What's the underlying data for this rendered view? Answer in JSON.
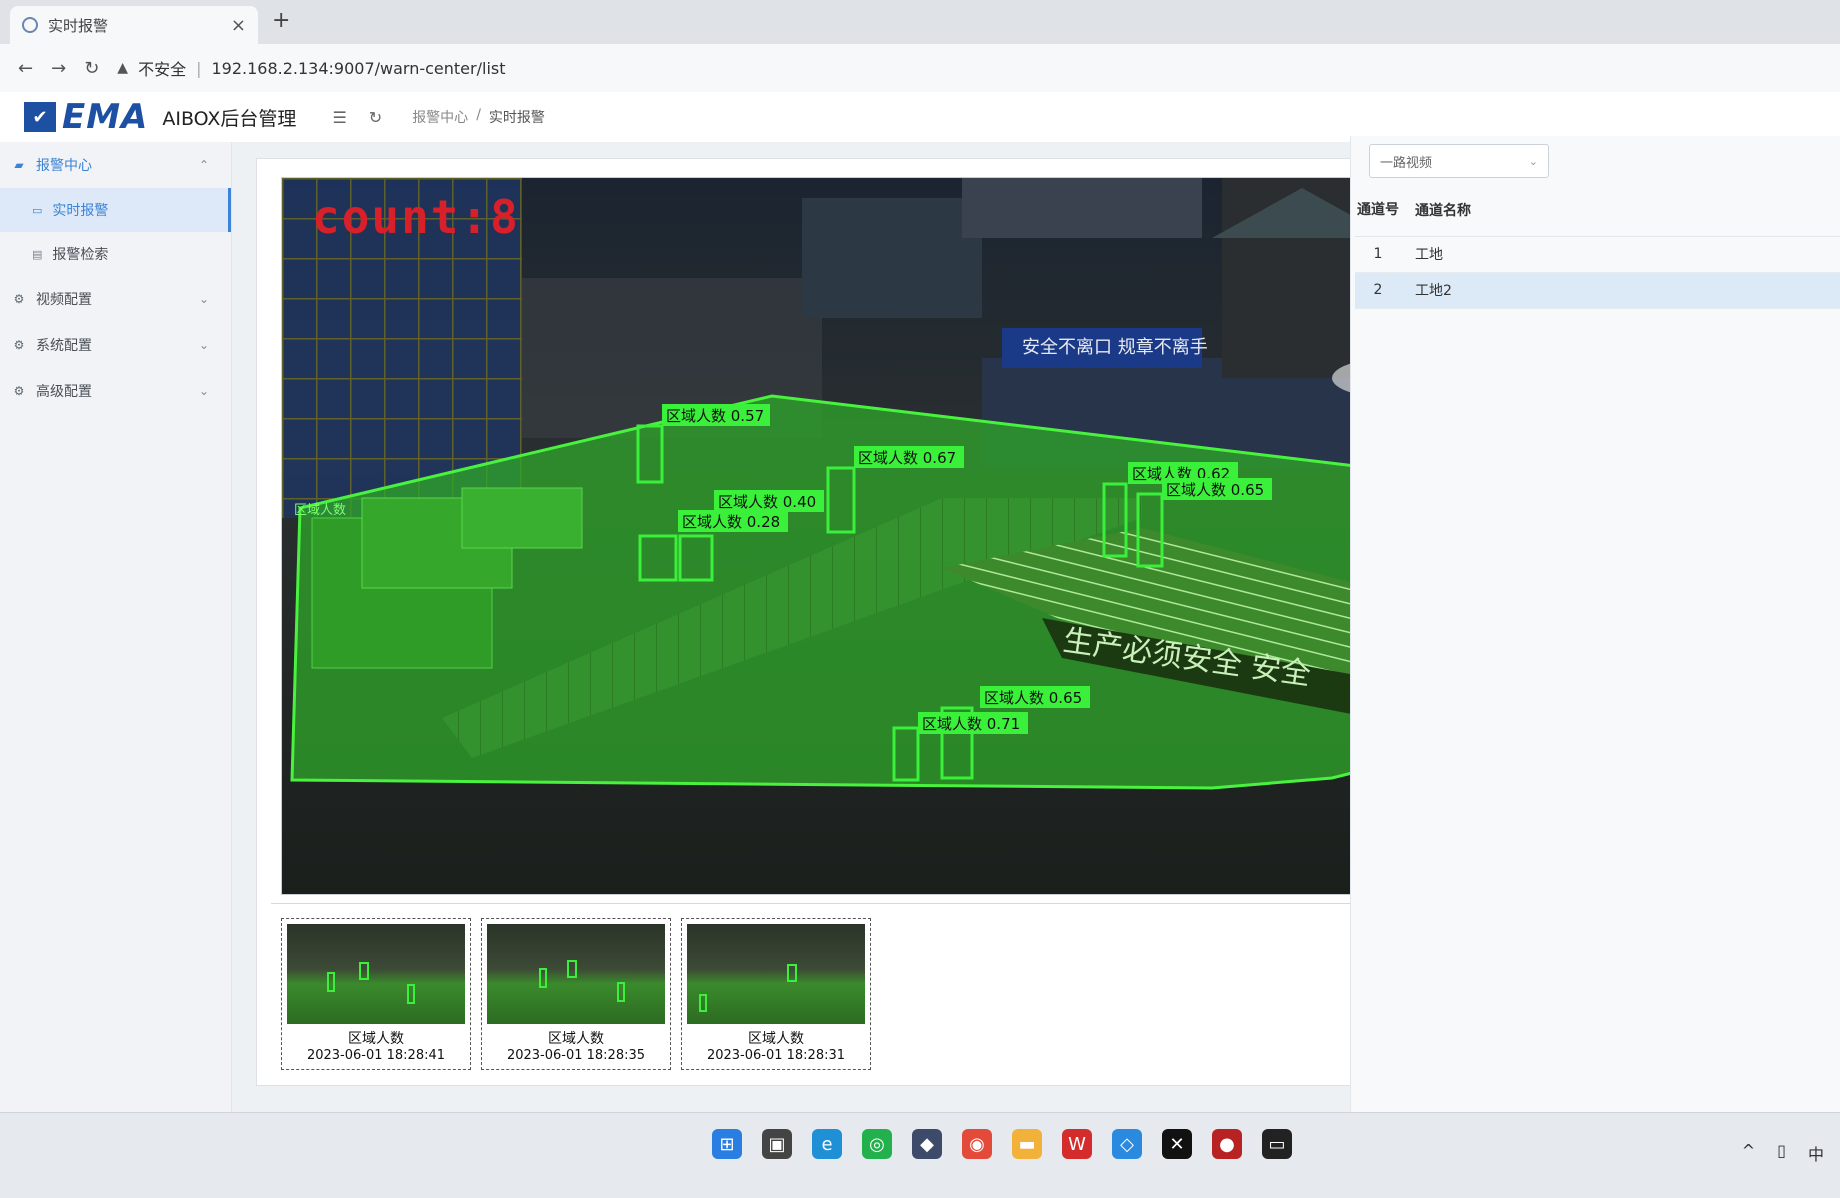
{
  "browser": {
    "tab_title": "实时报警",
    "tab_close": "×",
    "new_tab": "+",
    "security_label": "不安全",
    "url": "192.168.2.134:9007/warn-center/list"
  },
  "header": {
    "logo_text": "EMA",
    "app_title": "AIBOX后台管理",
    "breadcrumb": [
      "报警中心",
      "实时报警"
    ]
  },
  "sidebar": {
    "groups": [
      {
        "label": "报警中心",
        "icon": "alarm-icon",
        "expanded": true
      },
      {
        "label": "视频配置",
        "icon": "video-config-icon",
        "expanded": false
      },
      {
        "label": "系统配置",
        "icon": "gear-icon",
        "expanded": false
      },
      {
        "label": "高级配置",
        "icon": "advanced-gear-icon",
        "expanded": false
      }
    ],
    "sub_items": [
      {
        "label": "实时报警",
        "selected": true
      },
      {
        "label": "报警检索",
        "selected": false
      }
    ]
  },
  "video": {
    "count_text": "count:8",
    "zone_label": "区域人数",
    "detections": [
      {
        "label": "区域人数 0.57"
      },
      {
        "label": "区域人数 0.67"
      },
      {
        "label": "区域人数 0.40"
      },
      {
        "label": "区域人数 0.28"
      },
      {
        "label": "区域人数 0.62"
      },
      {
        "label": "区域人数 0.65"
      },
      {
        "label": "区域人数 0.65"
      },
      {
        "label": "区域人数 0.71"
      }
    ],
    "scene_signs": [
      "安全不离口 规章不离手",
      "生产必须安全 安全"
    ],
    "accent_color": "#3af03a"
  },
  "thumbnails": [
    {
      "label": "区域人数",
      "time": "2023-06-01 18:28:41"
    },
    {
      "label": "区域人数",
      "time": "2023-06-01 18:28:35"
    },
    {
      "label": "区域人数",
      "time": "2023-06-01 18:28:31"
    }
  ],
  "right_panel": {
    "select_value": "一路视频",
    "table_headers": {
      "num": "通道号",
      "name": "通道名称"
    },
    "channels": [
      {
        "num": "1",
        "name": "工地",
        "selected": false
      },
      {
        "num": "2",
        "name": "工地2",
        "selected": true
      }
    ]
  },
  "taskbar": {
    "apps": [
      "windows-start-icon",
      "task-view-icon",
      "edge-icon",
      "wechat-icon",
      "cat-app-icon",
      "chrome-icon",
      "file-explorer-icon",
      "wps-icon",
      "vpn-icon",
      "capcut-icon",
      "media-icon",
      "terminal-icon"
    ],
    "tray": [
      "^",
      "中"
    ]
  }
}
